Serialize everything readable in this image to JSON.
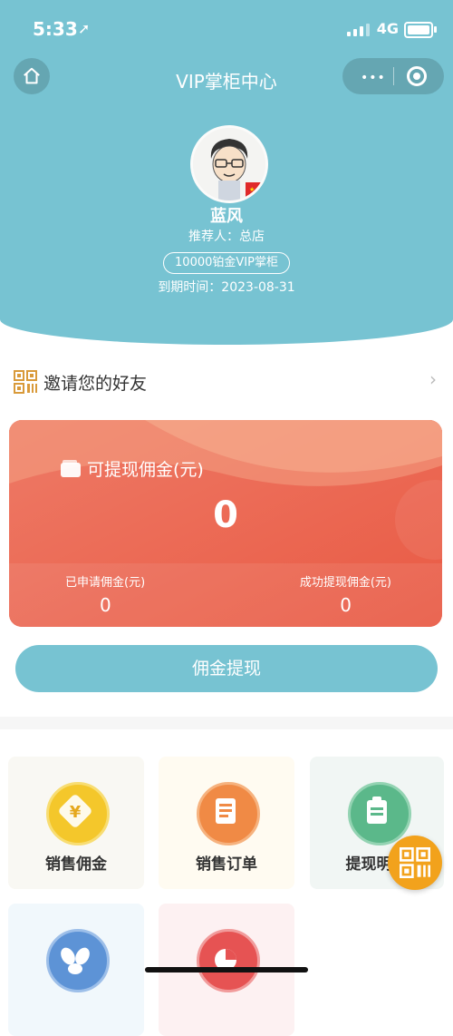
{
  "status_bar": {
    "time": "5:33",
    "network": "4G"
  },
  "nav": {
    "title": "VIP掌柜中心",
    "more_label": "•••"
  },
  "profile": {
    "name": "蓝风",
    "referrer": "推荐人：总店",
    "level": "10000铂金VIP掌柜",
    "expire": "到期时间：2023-08-31"
  },
  "invite": {
    "label": "邀请您的好友",
    "chevron": "›"
  },
  "wallet": {
    "label": "可提现佣金(元)",
    "amount": "0",
    "applied_label": "已申请佣金(元)",
    "applied_value": "0",
    "withdrawn_label": "成功提现佣金(元)",
    "withdrawn_value": "0"
  },
  "withdraw_button": "佣金提现",
  "grid": [
    {
      "label": "销售佣金",
      "icon": "yen-coin-icon",
      "color": "#f4c72b"
    },
    {
      "label": "销售订单",
      "icon": "document-icon",
      "color": "#f08a45"
    },
    {
      "label": "提现明",
      "icon": "clipboard-icon",
      "color": "#5bb88a"
    },
    {
      "label": "",
      "icon": "team-icon",
      "color": "#5d93d6"
    },
    {
      "label": "",
      "icon": "pie-chart-icon",
      "color": "#e65353"
    }
  ],
  "colors": {
    "theme": "#77c3d2",
    "wallet": "#ea6650",
    "float": "#f2a21c"
  }
}
